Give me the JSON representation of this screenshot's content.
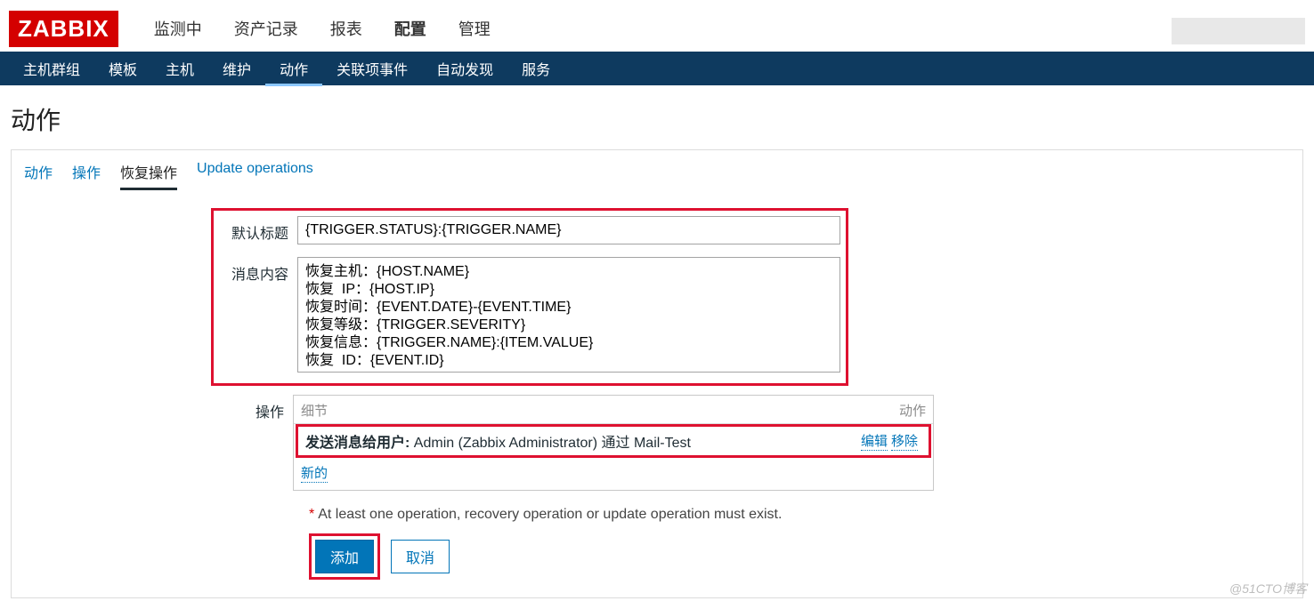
{
  "logo": "ZABBIX",
  "main_nav": {
    "items": [
      "监测中",
      "资产记录",
      "报表",
      "配置",
      "管理"
    ],
    "active_index": 3
  },
  "sub_nav": {
    "items": [
      "主机群组",
      "模板",
      "主机",
      "维护",
      "动作",
      "关联项事件",
      "自动发现",
      "服务"
    ],
    "active_index": 4
  },
  "page_title": "动作",
  "tabs": {
    "items": [
      "动作",
      "操作",
      "恢复操作",
      "Update operations"
    ],
    "active_index": 2
  },
  "fields": {
    "subject_label": "默认标题",
    "subject_value": "{TRIGGER.STATUS}:{TRIGGER.NAME}",
    "message_label": "消息内容",
    "message_value": "恢复主机：{HOST.NAME}\n恢复  IP：{HOST.IP}\n恢复时间：{EVENT.DATE}-{EVENT.TIME}\n恢复等级：{TRIGGER.SEVERITY}\n恢复信息：{TRIGGER.NAME}:{ITEM.VALUE}\n恢复  ID：{EVENT.ID}",
    "operations_label": "操作"
  },
  "op_table": {
    "col_detail": "细节",
    "col_action": "动作",
    "row_bold": "发送消息给用户:",
    "row_rest": " Admin (Zabbix Administrator) 通过 Mail-Test",
    "edit": "编辑",
    "remove": "移除",
    "new": "新的"
  },
  "hint": {
    "asterisk": "*",
    "text": "At least one operation, recovery operation or update operation must exist."
  },
  "buttons": {
    "submit": "添加",
    "cancel": "取消"
  },
  "watermark": "@51CTO博客"
}
